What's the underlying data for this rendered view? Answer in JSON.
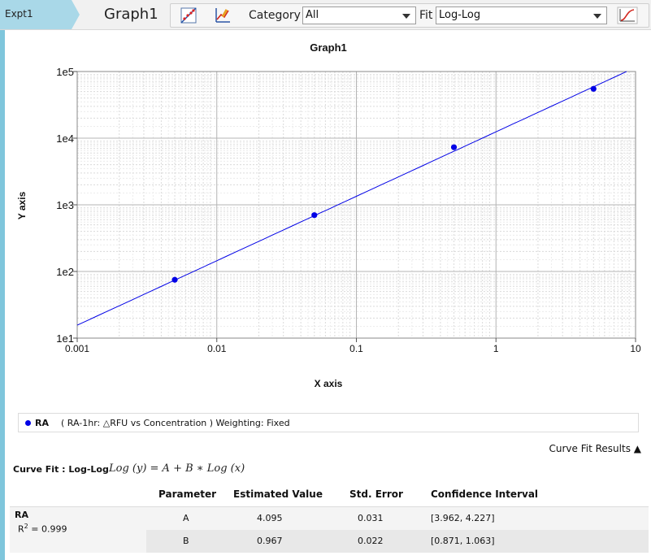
{
  "breadcrumb": {
    "label": "Expt1"
  },
  "tab": {
    "title": "Graph1"
  },
  "toolbar": {
    "icons": [
      "scatter-chart-icon",
      "edit-chart-icon"
    ],
    "category_label": "Category",
    "category_value": "All",
    "fit_label": "Fit",
    "fit_value": "Log-Log",
    "curve_icon": "sigmoid-curve-icon"
  },
  "chart_data": {
    "type": "scatter",
    "title": "Graph1",
    "xlabel": "X axis",
    "ylabel": "Y axis",
    "x_scale": "log",
    "y_scale": "log",
    "xlim": [
      0.001,
      10
    ],
    "ylim": [
      10,
      100000
    ],
    "x_ticks": [
      "0.001",
      "0.01",
      "0.1",
      "1",
      "10"
    ],
    "y_ticks": [
      "1e1",
      "1e2",
      "1e3",
      "1e4",
      "1e5"
    ],
    "grid": true,
    "series": [
      {
        "name": "RA",
        "color": "#0000e6",
        "points": [
          {
            "x": 0.005,
            "y": 75
          },
          {
            "x": 0.05,
            "y": 700
          },
          {
            "x": 0.5,
            "y": 7300
          },
          {
            "x": 5,
            "y": 55000
          }
        ],
        "fit": {
          "A": 4.095,
          "B": 0.967
        }
      }
    ]
  },
  "legend": {
    "series_name": "RA",
    "description": "( RA-1hr: △RFU vs Concentration )  Weighting: Fixed"
  },
  "results": {
    "toggle_label": "Curve Fit Results ▲",
    "fit_prefix": "Curve Fit : Log-Log",
    "equation": "Log (y) = A + B ∗ Log (x)",
    "headers": [
      "Parameter",
      "Estimated Value",
      "Std. Error",
      "Confidence Interval"
    ],
    "series_label": "RA",
    "r2_label": "R",
    "r2_sup": "2",
    "r2_value": " = 0.999",
    "rows": [
      {
        "param": "A",
        "value": "4.095",
        "stderr": "0.031",
        "ci": "[3.962, 4.227]"
      },
      {
        "param": "B",
        "value": "0.967",
        "stderr": "0.022",
        "ci": "[0.871, 1.063]"
      }
    ]
  }
}
